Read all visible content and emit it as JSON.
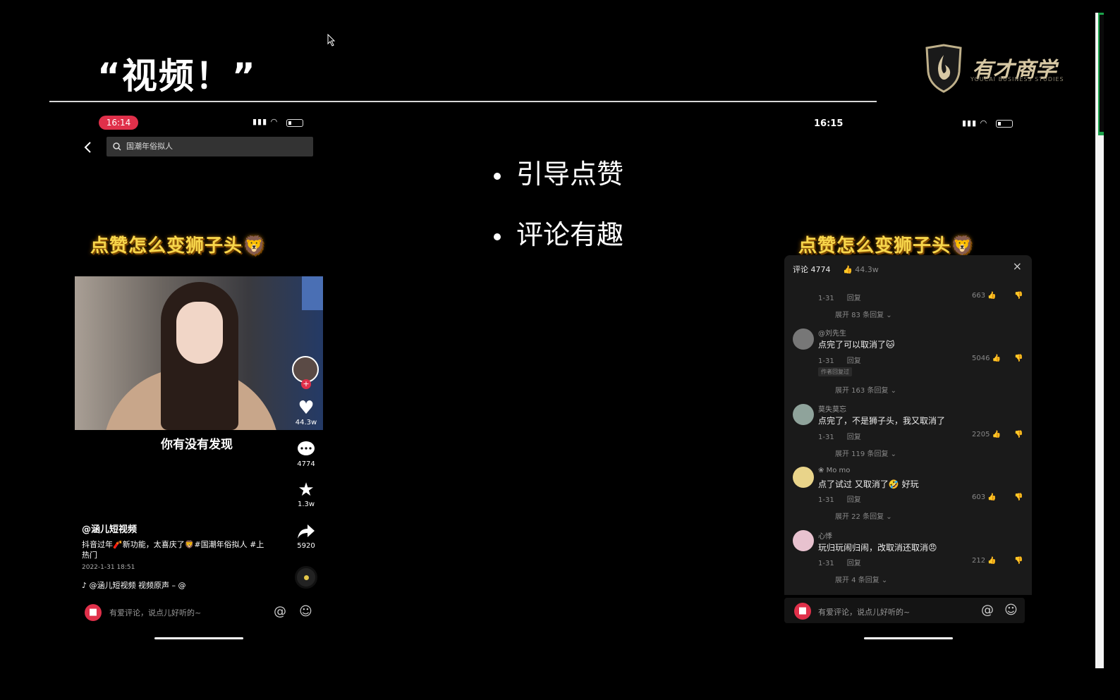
{
  "slide": {
    "title": "“视频！”",
    "bullets": [
      "引导点赞",
      "评论有趣"
    ],
    "logo": {
      "name": "有才商学",
      "subtitle": "YOUCAI BUSINESS STUDIES"
    }
  },
  "phone_left": {
    "time": "16:14",
    "search_placeholder": "国潮年俗拟人",
    "video_title": "点赞怎么变狮子头",
    "emoji": "🦁",
    "caption": "你有没有发现",
    "likes": "44.3w",
    "comments": "4774",
    "favorites": "1.3w",
    "shares": "5920",
    "author": "@涵儿短视频",
    "description": "抖音过年🧨新功能，太喜庆了🦁#国潮年俗拟人 #上热门",
    "date": "2022-1-31 18:51",
    "music": "@涵儿短视频   视频原声 – @",
    "comment_placeholder": "有爱评论，说点儿好听的~"
  },
  "phone_right": {
    "time": "16:15",
    "video_title": "点赞怎么变狮子头",
    "emoji": "🦁",
    "panel": {
      "comment_count": "评论 4774",
      "like_count": "44.3w",
      "close": "×",
      "top_item": {
        "date": "1-31",
        "reply": "回复",
        "likes": "663",
        "expand": "展开 83 条回复"
      },
      "comments": [
        {
          "name": "@刘先生",
          "text": "点完了可以取消了🐱",
          "date": "1-31",
          "reply": "回复",
          "likes": "5046",
          "badge": "作者回复过",
          "expand": "展开 163 条回复"
        },
        {
          "name": "莫失莫忘",
          "text": "点完了，不是狮子头，我又取消了",
          "date": "1-31",
          "reply": "回复",
          "likes": "2205",
          "expand": "展开 119 条回复"
        },
        {
          "name": "Mo mo",
          "text": "点了试过 又取消了🤣 好玩",
          "date": "1-31",
          "reply": "回复",
          "likes": "603",
          "expand": "展开 22 条回复"
        },
        {
          "name": "心悸",
          "text": "玩归玩闹归闹，改取消还取消😠",
          "date": "1-31",
          "reply": "回复",
          "likes": "212",
          "expand": "展开 4 条回复"
        }
      ]
    },
    "comment_placeholder": "有爱评论，说点儿好听的~"
  },
  "colors": {
    "accent_red": "#e0304a",
    "title_yellow": "#f7d64b",
    "logo_gold": "#d7c8a4"
  }
}
